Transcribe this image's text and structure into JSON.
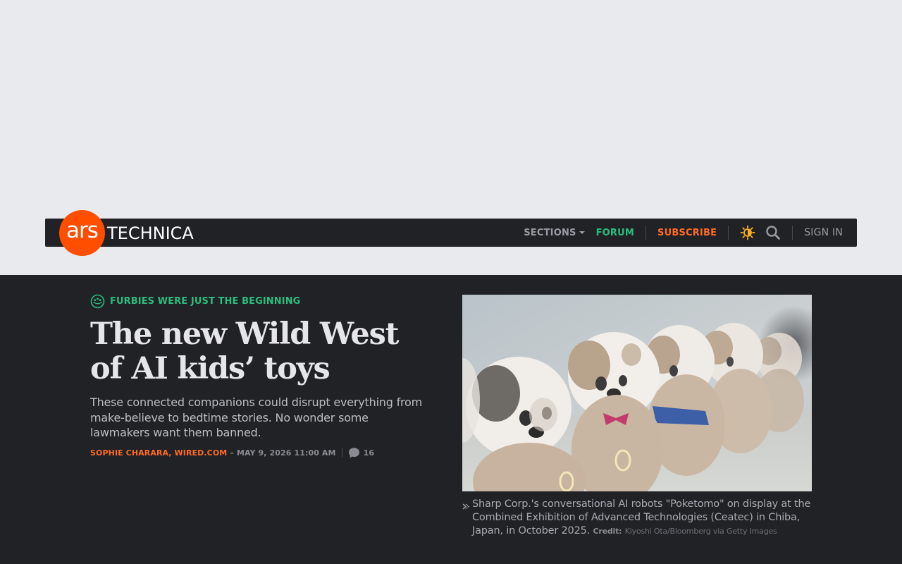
{
  "site": {
    "logo_ars": "ars",
    "logo_word": "TECHNICA",
    "brand_color": "#ff4e00"
  },
  "nav": {
    "sections": "SECTIONS",
    "forum": "FORUM",
    "subscribe": "SUBSCRIBE",
    "theme_icon": "sun-icon",
    "search_icon": "search-icon",
    "sign_in": "SIGN IN"
  },
  "article": {
    "kicker": "FURBIES WERE JUST THE BEGINNING",
    "headline": "The new Wild West of AI kids’ toys",
    "dek": "These connected companions could disrupt everything from make-believe to bedtime stories. No wonder some lawmakers want them banned.",
    "author": "SOPHIE CHARARA, WIRED.COM",
    "dash": "–",
    "date": "MAY 9, 2026 11:00 AM",
    "comment_count": "16"
  },
  "photo": {
    "caption": "Sharp Corp.'s conversational AI robots \"Poketomo\" on display at the Combined Exhibition of Advanced Technologies (Ceatec) in Chiba, Japan, in October 2025.",
    "credit_label": "Credit:",
    "credit_value": "Kiyoshi Ota/Bloomberg via Getty Images"
  }
}
